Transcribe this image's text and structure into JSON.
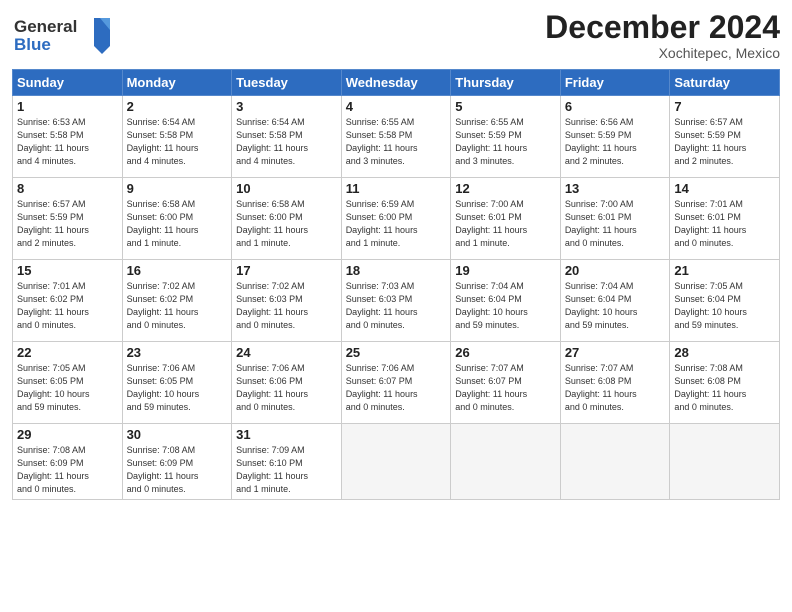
{
  "header": {
    "logo_line1": "General",
    "logo_line2": "Blue",
    "month_title": "December 2024",
    "location": "Xochitepec, Mexico"
  },
  "weekdays": [
    "Sunday",
    "Monday",
    "Tuesday",
    "Wednesday",
    "Thursday",
    "Friday",
    "Saturday"
  ],
  "weeks": [
    [
      {
        "day": "1",
        "info": "Sunrise: 6:53 AM\nSunset: 5:58 PM\nDaylight: 11 hours\nand 4 minutes."
      },
      {
        "day": "2",
        "info": "Sunrise: 6:54 AM\nSunset: 5:58 PM\nDaylight: 11 hours\nand 4 minutes."
      },
      {
        "day": "3",
        "info": "Sunrise: 6:54 AM\nSunset: 5:58 PM\nDaylight: 11 hours\nand 4 minutes."
      },
      {
        "day": "4",
        "info": "Sunrise: 6:55 AM\nSunset: 5:58 PM\nDaylight: 11 hours\nand 3 minutes."
      },
      {
        "day": "5",
        "info": "Sunrise: 6:55 AM\nSunset: 5:59 PM\nDaylight: 11 hours\nand 3 minutes."
      },
      {
        "day": "6",
        "info": "Sunrise: 6:56 AM\nSunset: 5:59 PM\nDaylight: 11 hours\nand 2 minutes."
      },
      {
        "day": "7",
        "info": "Sunrise: 6:57 AM\nSunset: 5:59 PM\nDaylight: 11 hours\nand 2 minutes."
      }
    ],
    [
      {
        "day": "8",
        "info": "Sunrise: 6:57 AM\nSunset: 5:59 PM\nDaylight: 11 hours\nand 2 minutes."
      },
      {
        "day": "9",
        "info": "Sunrise: 6:58 AM\nSunset: 6:00 PM\nDaylight: 11 hours\nand 1 minute."
      },
      {
        "day": "10",
        "info": "Sunrise: 6:58 AM\nSunset: 6:00 PM\nDaylight: 11 hours\nand 1 minute."
      },
      {
        "day": "11",
        "info": "Sunrise: 6:59 AM\nSunset: 6:00 PM\nDaylight: 11 hours\nand 1 minute."
      },
      {
        "day": "12",
        "info": "Sunrise: 7:00 AM\nSunset: 6:01 PM\nDaylight: 11 hours\nand 1 minute."
      },
      {
        "day": "13",
        "info": "Sunrise: 7:00 AM\nSunset: 6:01 PM\nDaylight: 11 hours\nand 0 minutes."
      },
      {
        "day": "14",
        "info": "Sunrise: 7:01 AM\nSunset: 6:01 PM\nDaylight: 11 hours\nand 0 minutes."
      }
    ],
    [
      {
        "day": "15",
        "info": "Sunrise: 7:01 AM\nSunset: 6:02 PM\nDaylight: 11 hours\nand 0 minutes."
      },
      {
        "day": "16",
        "info": "Sunrise: 7:02 AM\nSunset: 6:02 PM\nDaylight: 11 hours\nand 0 minutes."
      },
      {
        "day": "17",
        "info": "Sunrise: 7:02 AM\nSunset: 6:03 PM\nDaylight: 11 hours\nand 0 minutes."
      },
      {
        "day": "18",
        "info": "Sunrise: 7:03 AM\nSunset: 6:03 PM\nDaylight: 11 hours\nand 0 minutes."
      },
      {
        "day": "19",
        "info": "Sunrise: 7:04 AM\nSunset: 6:04 PM\nDaylight: 10 hours\nand 59 minutes."
      },
      {
        "day": "20",
        "info": "Sunrise: 7:04 AM\nSunset: 6:04 PM\nDaylight: 10 hours\nand 59 minutes."
      },
      {
        "day": "21",
        "info": "Sunrise: 7:05 AM\nSunset: 6:04 PM\nDaylight: 10 hours\nand 59 minutes."
      }
    ],
    [
      {
        "day": "22",
        "info": "Sunrise: 7:05 AM\nSunset: 6:05 PM\nDaylight: 10 hours\nand 59 minutes."
      },
      {
        "day": "23",
        "info": "Sunrise: 7:06 AM\nSunset: 6:05 PM\nDaylight: 10 hours\nand 59 minutes."
      },
      {
        "day": "24",
        "info": "Sunrise: 7:06 AM\nSunset: 6:06 PM\nDaylight: 11 hours\nand 0 minutes."
      },
      {
        "day": "25",
        "info": "Sunrise: 7:06 AM\nSunset: 6:07 PM\nDaylight: 11 hours\nand 0 minutes."
      },
      {
        "day": "26",
        "info": "Sunrise: 7:07 AM\nSunset: 6:07 PM\nDaylight: 11 hours\nand 0 minutes."
      },
      {
        "day": "27",
        "info": "Sunrise: 7:07 AM\nSunset: 6:08 PM\nDaylight: 11 hours\nand 0 minutes."
      },
      {
        "day": "28",
        "info": "Sunrise: 7:08 AM\nSunset: 6:08 PM\nDaylight: 11 hours\nand 0 minutes."
      }
    ],
    [
      {
        "day": "29",
        "info": "Sunrise: 7:08 AM\nSunset: 6:09 PM\nDaylight: 11 hours\nand 0 minutes."
      },
      {
        "day": "30",
        "info": "Sunrise: 7:08 AM\nSunset: 6:09 PM\nDaylight: 11 hours\nand 0 minutes."
      },
      {
        "day": "31",
        "info": "Sunrise: 7:09 AM\nSunset: 6:10 PM\nDaylight: 11 hours\nand 1 minute."
      },
      {
        "day": "",
        "info": ""
      },
      {
        "day": "",
        "info": ""
      },
      {
        "day": "",
        "info": ""
      },
      {
        "day": "",
        "info": ""
      }
    ]
  ]
}
